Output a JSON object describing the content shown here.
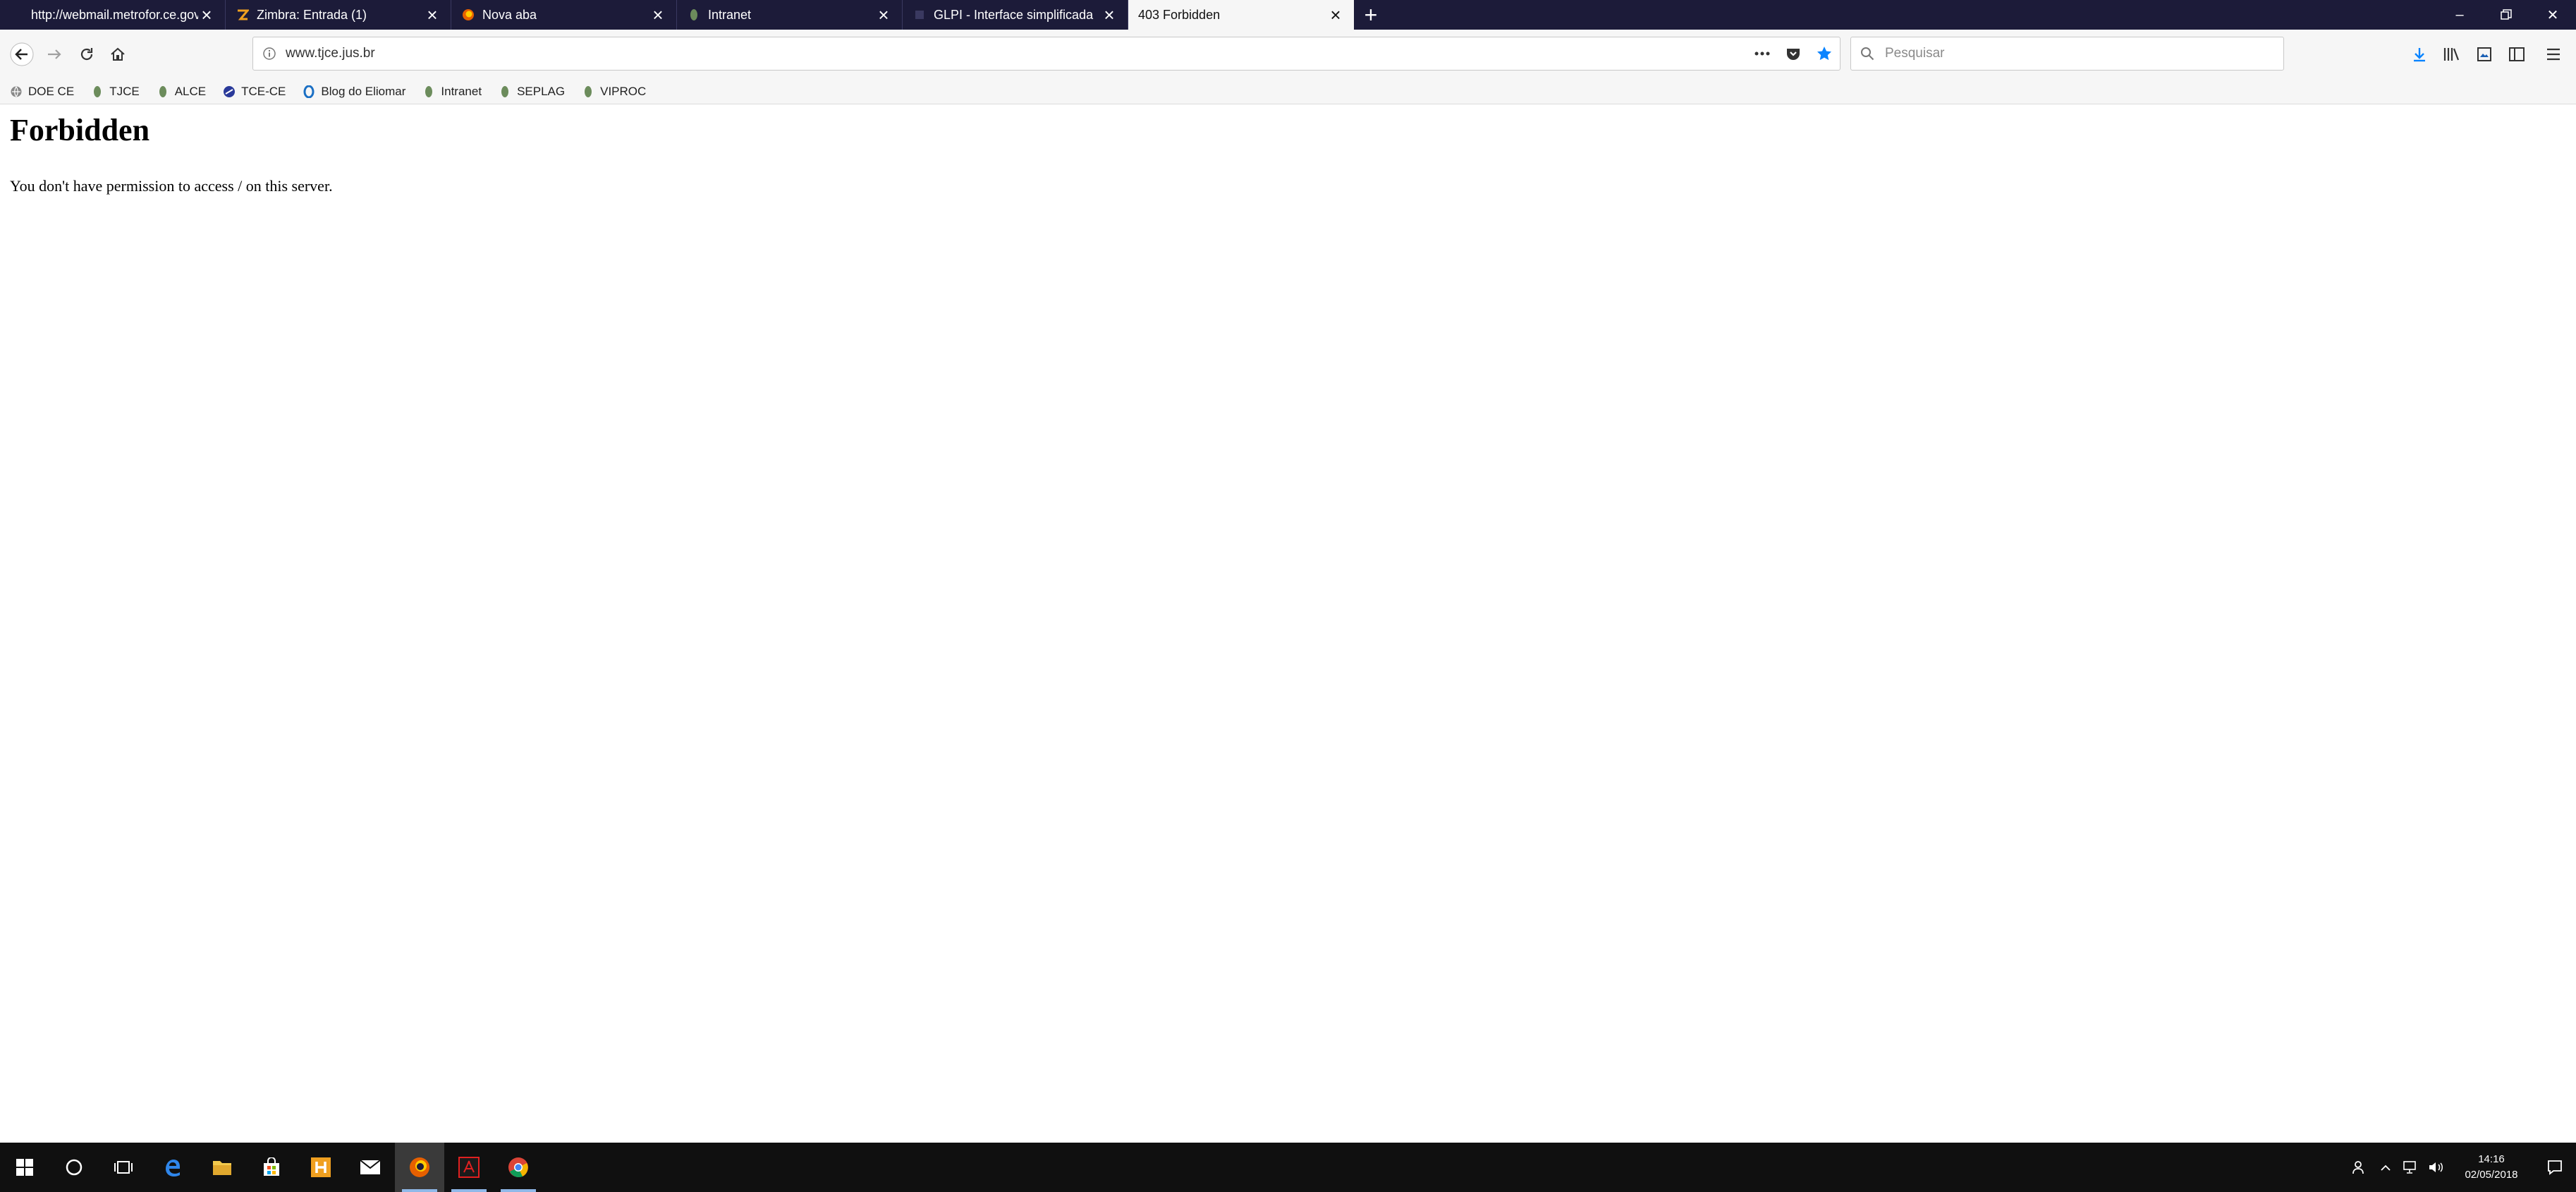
{
  "tabs": [
    {
      "title": "http://webmail.metrofor.ce.gov.br",
      "icon": "page-icon",
      "active": false
    },
    {
      "title": "Zimbra: Entrada (1)",
      "icon": "zimbra-icon",
      "active": false
    },
    {
      "title": "Nova aba",
      "icon": "firefox-icon",
      "active": false
    },
    {
      "title": "Intranet",
      "icon": "intranet-icon",
      "active": false
    },
    {
      "title": "GLPI - Interface simplificada",
      "icon": "glpi-icon",
      "active": false
    },
    {
      "title": "403 Forbidden",
      "icon": "none",
      "active": true
    }
  ],
  "navbar": {
    "url": "www.tjce.jus.br",
    "search_placeholder": "Pesquisar"
  },
  "bookmarks": [
    {
      "label": "DOE CE",
      "icon": "globe-icon"
    },
    {
      "label": "TJCE",
      "icon": "leaf-icon"
    },
    {
      "label": "ALCE",
      "icon": "leaf-icon"
    },
    {
      "label": "TCE-CE",
      "icon": "tce-icon"
    },
    {
      "label": "Blog do Eliomar",
      "icon": "blog-icon"
    },
    {
      "label": "Intranet",
      "icon": "leaf-icon"
    },
    {
      "label": "SEPLAG",
      "icon": "leaf-icon"
    },
    {
      "label": "VIPROC",
      "icon": "leaf-icon"
    }
  ],
  "page": {
    "heading": "Forbidden",
    "message": "You don't have permission to access / on this server."
  },
  "taskbar": {
    "time": "14:16",
    "date": "02/05/2018"
  },
  "colors": {
    "tabstrip": "#1c1b39",
    "toolbar": "#f6f6f6",
    "accent": "#0a84ff",
    "taskbar": "#101010"
  }
}
